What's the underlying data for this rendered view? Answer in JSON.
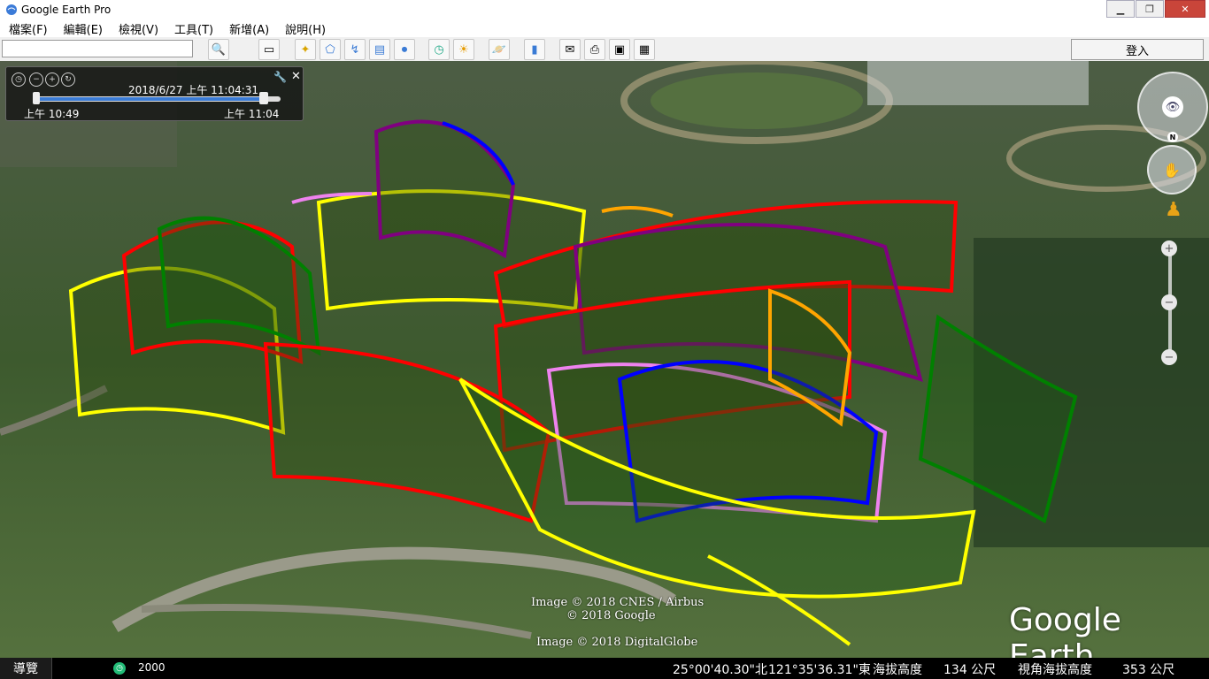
{
  "window": {
    "title": "Google Earth Pro"
  },
  "menu": {
    "items": [
      "檔案(F)",
      "編輯(E)",
      "檢視(V)",
      "工具(T)",
      "新增(A)",
      "說明(H)"
    ]
  },
  "toolbar": {
    "search_value": "",
    "login_label": "登入",
    "icons": [
      "search-icon",
      "sidebar-icon",
      "placemark-icon",
      "polygon-icon",
      "path-icon",
      "overlay-icon",
      "record-tour-icon",
      "historical-imagery-icon",
      "sunlight-icon",
      "planets-icon",
      "ruler-icon",
      "email-icon",
      "print-icon",
      "save-image-icon",
      "view-in-maps-icon"
    ]
  },
  "time_slider": {
    "current": "2018/6/27 上午  11:04:31",
    "start": "上午  10:49",
    "end": "上午  11:04",
    "progress": 1.0
  },
  "map": {
    "attribution_1": "Image © 2018 CNES / Airbus",
    "attribution_2": "© 2018 Google",
    "attribution_3": "Image © 2018 DigitalGlobe",
    "logo": "Google Earth",
    "north_label": "N",
    "track_colors": [
      "#ffff00",
      "#ff0000",
      "#008000",
      "#0000ff",
      "#800080",
      "#ee82ee",
      "#ffa500"
    ]
  },
  "status": {
    "tour_label": "導覽",
    "year": "2000",
    "lat": "25°00'40.30\"北",
    "lon": "121°35'36.31\"東",
    "alt_label": "海拔高度",
    "alt_value": "134 公尺",
    "eye_label": "視角海拔高度",
    "eye_value": "353 公尺"
  }
}
